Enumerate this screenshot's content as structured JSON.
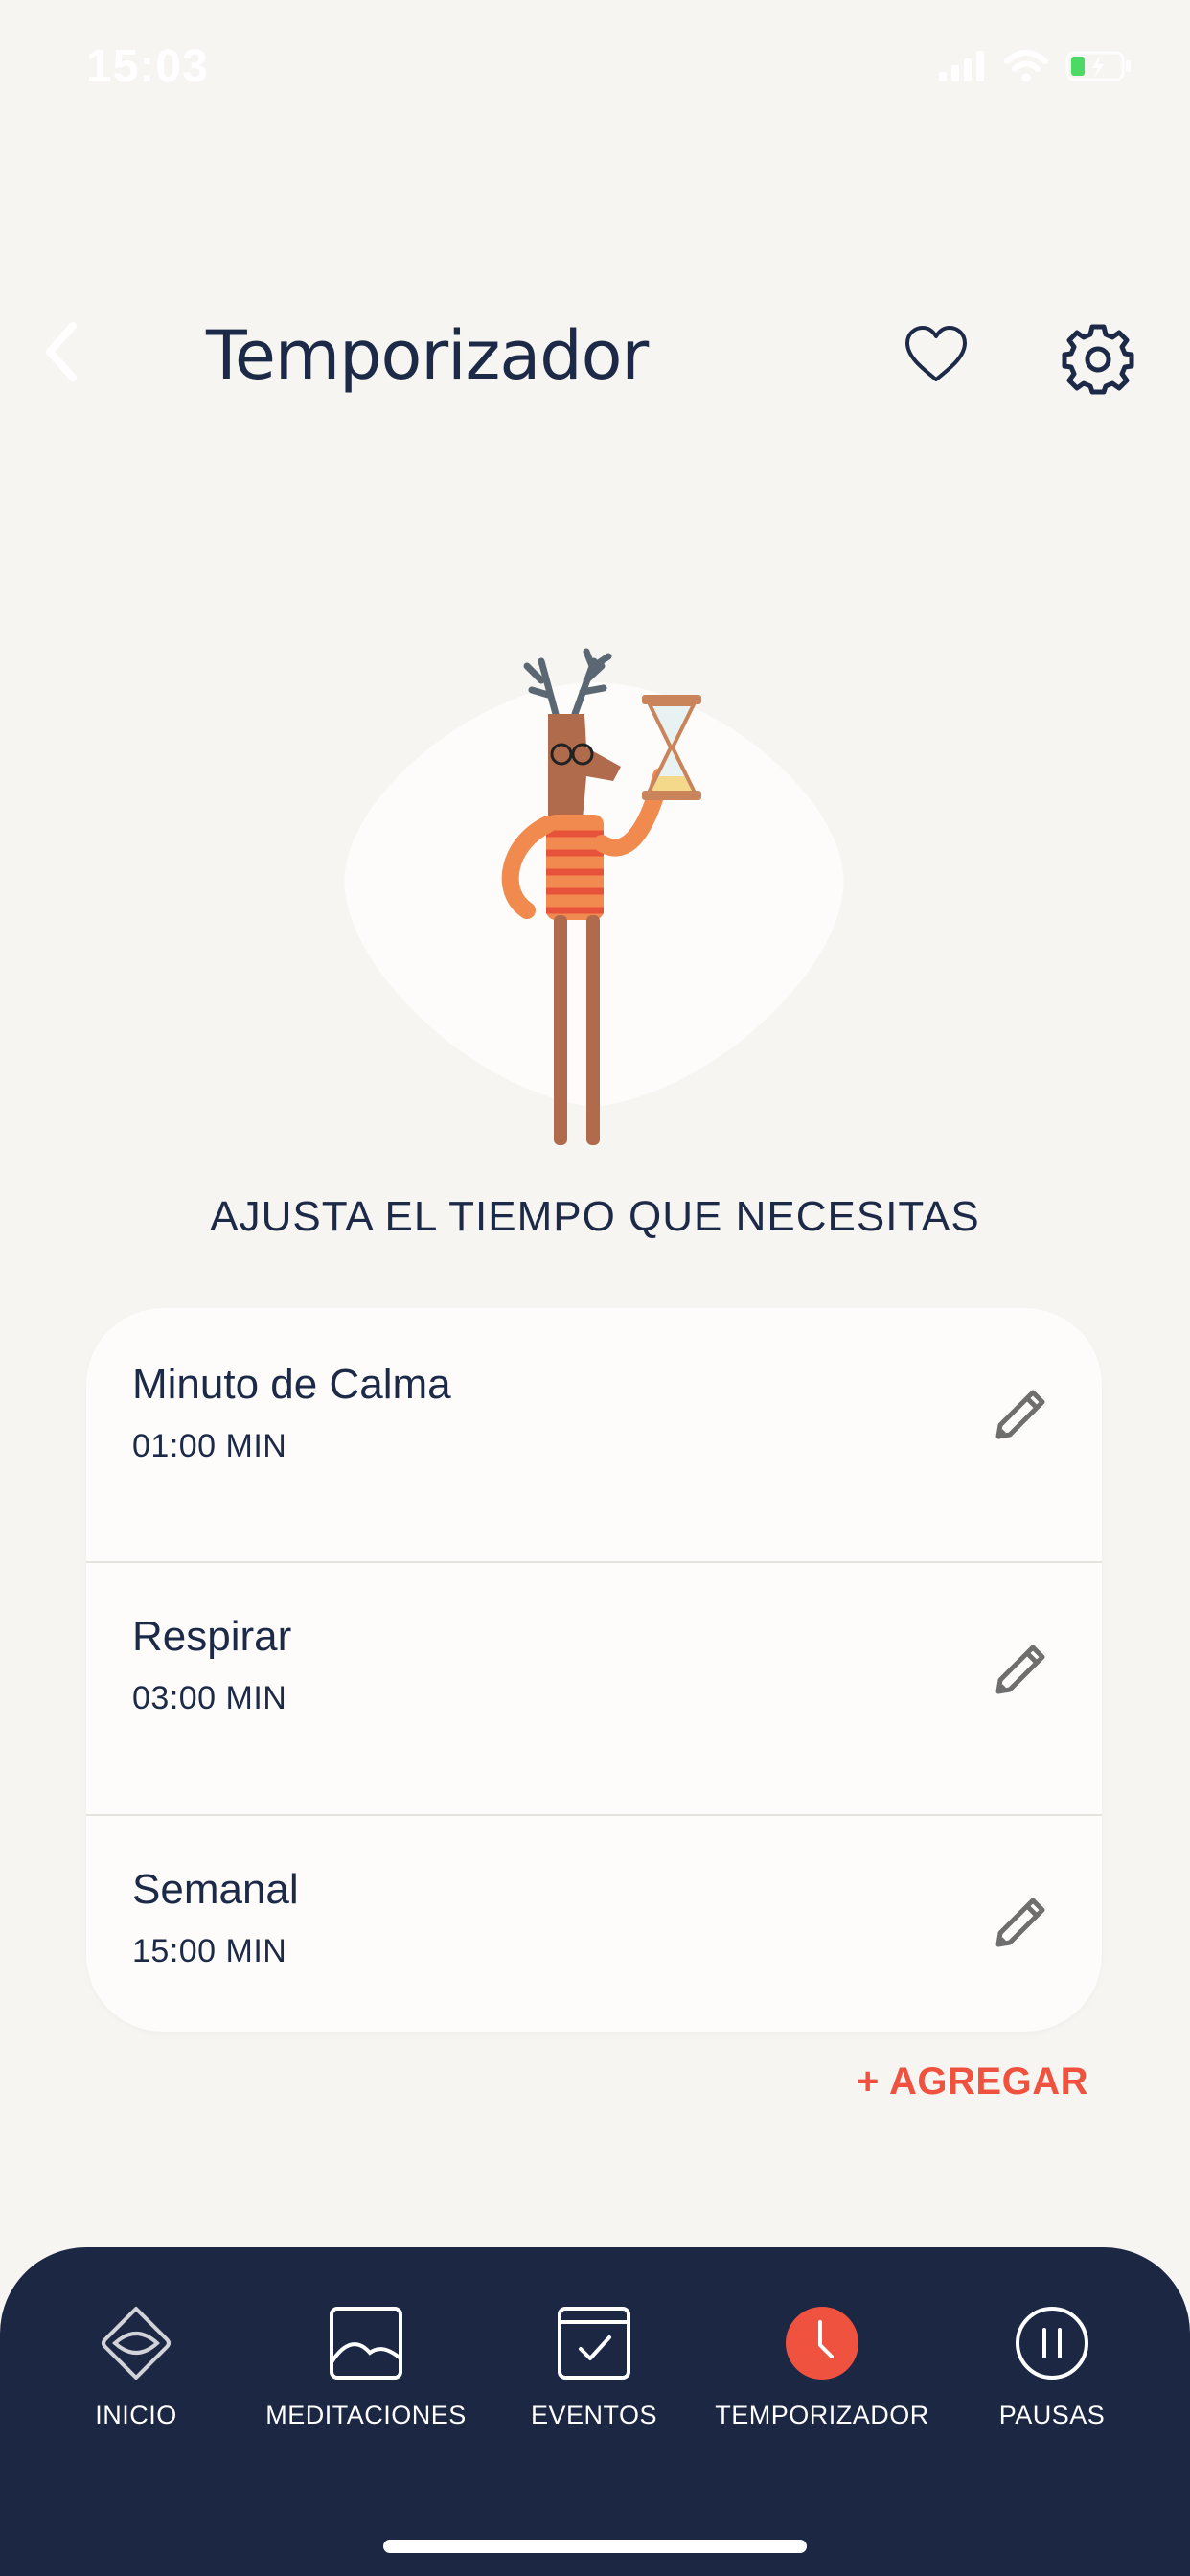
{
  "status_bar": {
    "time": "15:03"
  },
  "header": {
    "title": "Temporizador"
  },
  "subtitle": "AJUSTA EL TIEMPO QUE NECESITAS",
  "timers": [
    {
      "name": "Minuto de Calma",
      "duration": "01:00 MIN"
    },
    {
      "name": "Respirar",
      "duration": "03:00 MIN"
    },
    {
      "name": "Semanal",
      "duration": "15:00 MIN"
    }
  ],
  "add_label": "+ AGREGAR",
  "tabs": [
    {
      "label": "INICIO",
      "icon": "eye-diamond-icon"
    },
    {
      "label": "MEDITACIONES",
      "icon": "image-icon"
    },
    {
      "label": "EVENTOS",
      "icon": "calendar-check-icon"
    },
    {
      "label": "TEMPORIZADOR",
      "icon": "clock-icon",
      "active": true
    },
    {
      "label": "PAUSAS",
      "icon": "pause-icon"
    }
  ],
  "colors": {
    "background": "#f7f5f2",
    "text": "#1c2a48",
    "accent": "#ef5340",
    "tab_bar": "#1c2744",
    "card": "#fdfcfa"
  }
}
